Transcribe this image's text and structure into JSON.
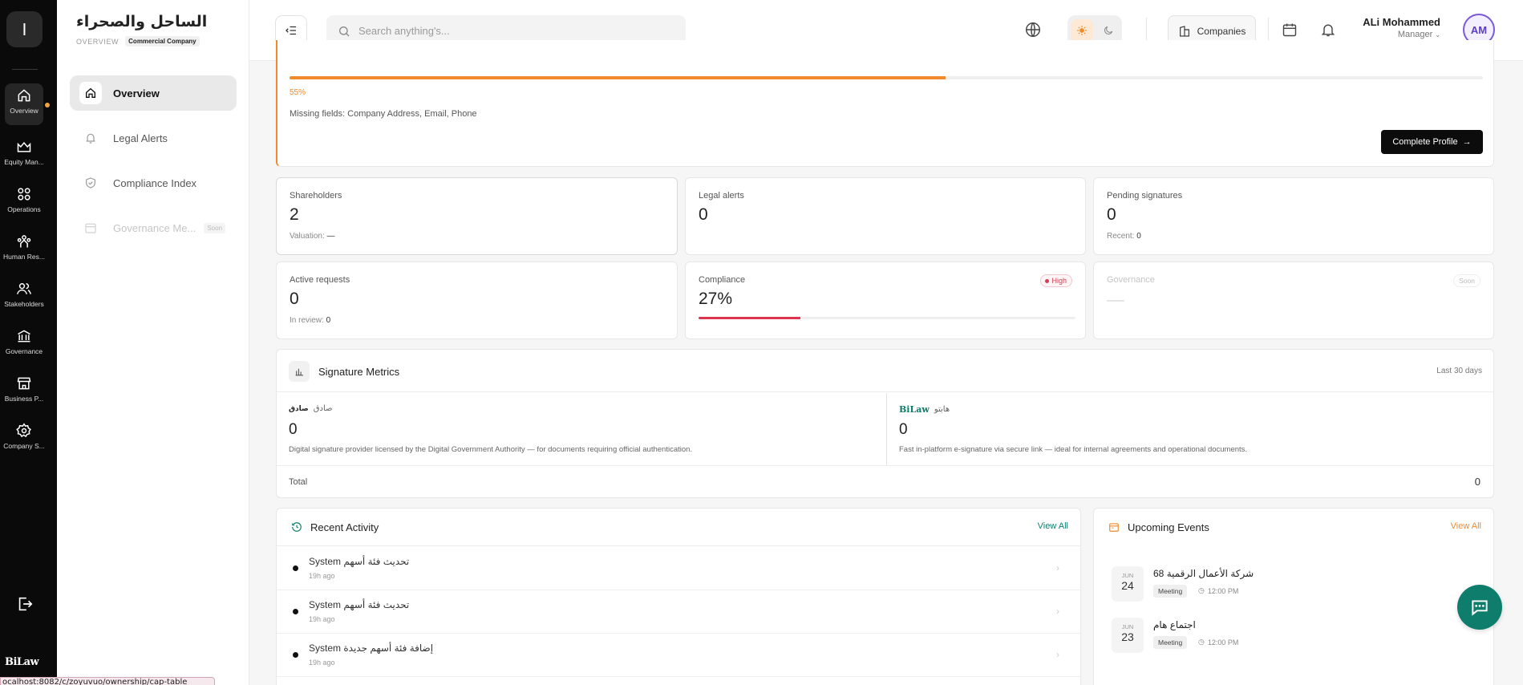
{
  "rail": {
    "logo_letter": "I",
    "items": [
      {
        "label": "Overview",
        "icon": "home-icon"
      },
      {
        "label": "Equity Man...",
        "icon": "crown-icon"
      },
      {
        "label": "Operations",
        "icon": "grid-icon"
      },
      {
        "label": "Human Res...",
        "icon": "people-icon"
      },
      {
        "label": "Stakeholders",
        "icon": "users-icon"
      },
      {
        "label": "Governance",
        "icon": "building-icon"
      },
      {
        "label": "Business P...",
        "icon": "store-icon"
      },
      {
        "label": "Company S...",
        "icon": "gear-icon"
      }
    ],
    "brand": "BiLaw"
  },
  "subnav": {
    "org_name": "الساحل والصحراء",
    "breadcrumb": "OVERVIEW",
    "company_type": "Commercial Company",
    "items": [
      {
        "label": "Overview"
      },
      {
        "label": "Legal Alerts"
      },
      {
        "label": "Compliance Index"
      },
      {
        "label": "Governance Me...",
        "badge": "Soon"
      }
    ]
  },
  "topbar": {
    "search_placeholder": "Search anything's...",
    "companies_label": "Companies",
    "user_name": "ALi Mohammed",
    "user_role": "Manager",
    "avatar_initials": "AM"
  },
  "profile": {
    "progress_pct": 55,
    "progress_text": "55%",
    "missing": "Missing fields: Company Address, Email, Phone",
    "complete_label": "Complete Profile"
  },
  "stats": {
    "shareholders": {
      "label": "Shareholders",
      "value": "2",
      "sub_label": "Valuation:",
      "sub_value": "—"
    },
    "legal_alerts": {
      "label": "Legal alerts",
      "value": "0"
    },
    "pending_signatures": {
      "label": "Pending signatures",
      "value": "0",
      "sub_label": "Recent:",
      "sub_value": "0"
    },
    "active_requests": {
      "label": "Active requests",
      "value": "0",
      "sub_label": "In review:",
      "sub_value": "0"
    },
    "compliance": {
      "label": "Compliance",
      "value": "27%",
      "progress_pct": 27,
      "badge": "High"
    },
    "governance": {
      "label": "Governance",
      "badge": "Soon"
    }
  },
  "signature": {
    "title": "Signature Metrics",
    "range": "Last 30 days",
    "providers": [
      {
        "logo_text": "صادق",
        "name": "صادق",
        "count": "0",
        "desc": "Digital signature provider licensed by the Digital Government Authority — for documents requiring official authentication."
      },
      {
        "logo_text": "BiLaw",
        "name": "هابتو",
        "count": "0",
        "desc": "Fast in-platform e-signature via secure link — ideal for internal agreements and operational documents."
      }
    ],
    "total_label": "Total",
    "total_value": "0"
  },
  "activity": {
    "title": "Recent Activity",
    "view_all": "View All",
    "rows": [
      {
        "actor": "System",
        "text": "تحديث فئة أسهم",
        "time": "19h ago"
      },
      {
        "actor": "System",
        "text": "تحديث فئة أسهم",
        "time": "19h ago"
      },
      {
        "actor": "System",
        "text": "إضافة فئة أسهم جديدة",
        "time": "19h ago"
      }
    ]
  },
  "events": {
    "title": "Upcoming Events",
    "view_all": "View All",
    "items": [
      {
        "month": "JUN",
        "day": "24",
        "title": "شركة الأعمال الرقمية 68",
        "tag": "Meeting",
        "time": "12:00 PM"
      },
      {
        "month": "JUN",
        "day": "23",
        "title": "اجتماع هام",
        "tag": "Meeting",
        "time": "12:00 PM"
      }
    ]
  },
  "status_url": "ocalhost:8082/c/zoyuvuo/ownership/cap-table",
  "colors": {
    "accent": "#f08a2a",
    "danger": "#e0334e",
    "brand": "#0f7d6b",
    "rail": "#0a0a0a"
  }
}
